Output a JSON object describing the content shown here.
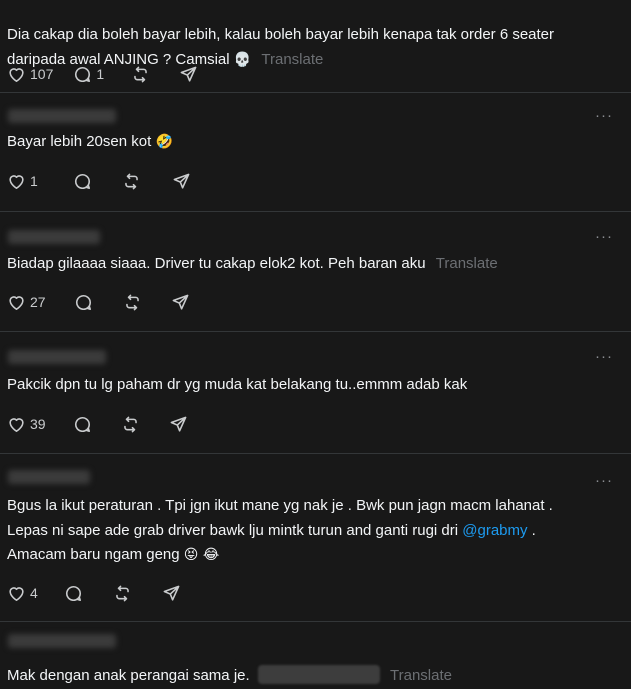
{
  "translate_label": "Translate",
  "more_label": "···",
  "posts": [
    {
      "text_lines": [
        "Dia cakap dia boleh bayar lebih, kalau boleh bayar lebih kenapa tak order 6 seater",
        "daripada awal ANJING ? Camsial"
      ],
      "emoji": "💀",
      "likes": "107",
      "replies": "1"
    },
    {
      "text": "Bayar lebih 20sen kot",
      "emoji": "🤣",
      "likes": "1"
    },
    {
      "text": "Biadap gilaaaa siaaa. Driver tu cakap elok2 kot. Peh baran aku",
      "likes": "27"
    },
    {
      "text": "Pakcik dpn tu lg paham dr yg muda kat belakang tu..emmm adab kak",
      "likes": "39"
    },
    {
      "line1": "Bgus la ikut peraturan . Tpi jgn ikut mane yg nak je . Bwk pun jagn macm lahanat .",
      "line2": "Lepas ni sape ade grab driver bawk lju mintk turun and ganti rugi dri",
      "mention": "@grabmy",
      "line2_end": " .",
      "line3": "Amacam baru ngam geng",
      "emoji": "😝 😂",
      "likes": "4"
    },
    {
      "text": "Mak dengan anak perangai sama je."
    }
  ]
}
